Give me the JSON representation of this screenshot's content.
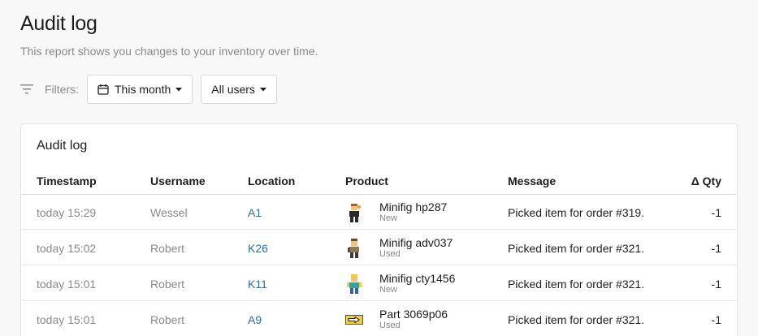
{
  "page": {
    "title": "Audit log",
    "subtitle": "This report shows you changes to your inventory over time."
  },
  "filters": {
    "label": "Filters:",
    "period": "This month",
    "users": "All users"
  },
  "card": {
    "title": "Audit log",
    "columns": [
      "Timestamp",
      "Username",
      "Location",
      "Product",
      "Message",
      "Δ Qty"
    ],
    "rows": [
      {
        "timestamp": "today 15:29",
        "username": "Wessel",
        "location": "A1",
        "product": "Minifig hp287",
        "condition": "New",
        "message": "Picked item for order #319.",
        "qty": "-1",
        "icon": "minifig-hp287-icon"
      },
      {
        "timestamp": "today 15:02",
        "username": "Robert",
        "location": "K26",
        "product": "Minifig adv037",
        "condition": "Used",
        "message": "Picked item for order #321.",
        "qty": "-1",
        "icon": "minifig-adv037-icon"
      },
      {
        "timestamp": "today 15:01",
        "username": "Robert",
        "location": "K11",
        "product": "Minifig cty1456",
        "condition": "New",
        "message": "Picked item for order #321.",
        "qty": "-1",
        "icon": "minifig-cty1456-icon"
      },
      {
        "timestamp": "today 15:01",
        "username": "Robert",
        "location": "A9",
        "product": "Part 3069p06",
        "condition": "Used",
        "message": "Picked item for order #321.",
        "qty": "-1",
        "icon": "part-3069p06-icon"
      }
    ]
  },
  "colors": {
    "link": "#2f6bb0",
    "muted": "#8a8a8e",
    "background": "#f8f8f9"
  }
}
